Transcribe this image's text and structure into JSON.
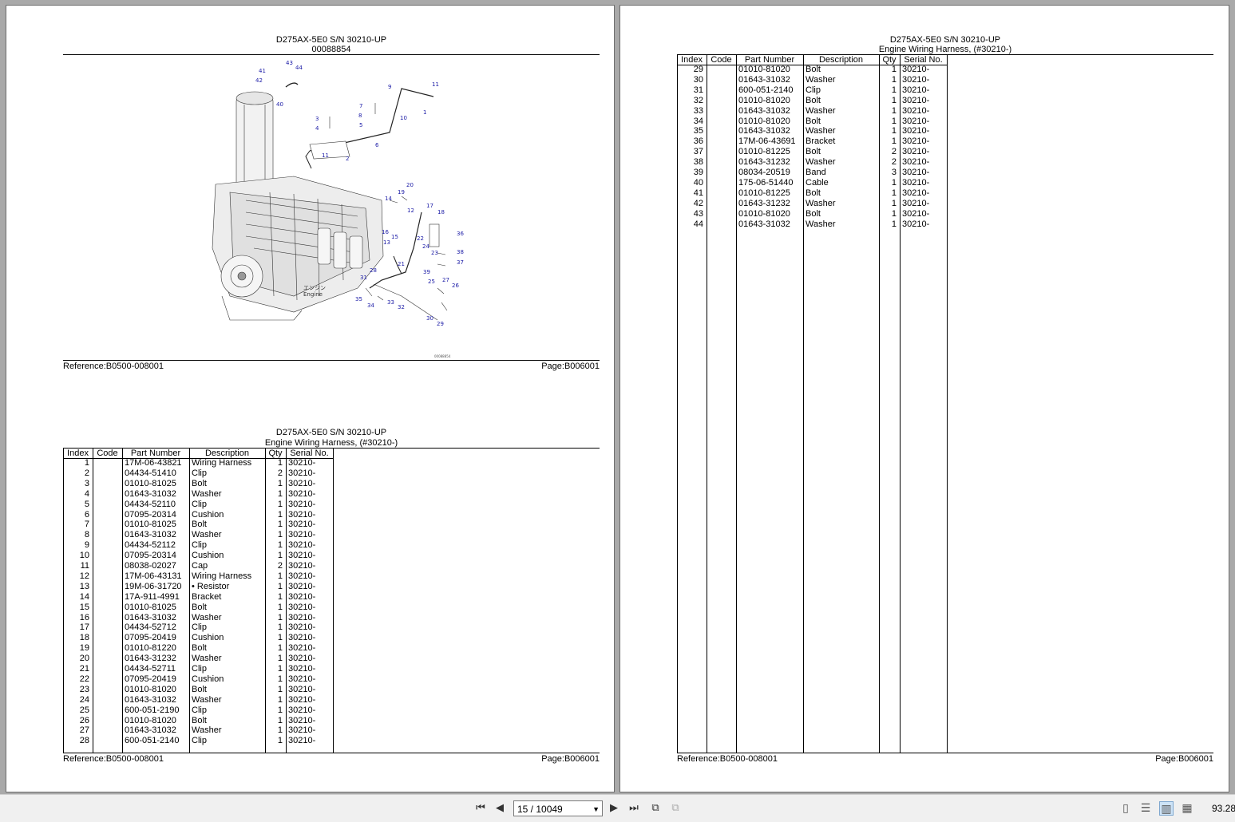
{
  "viewer": {
    "page_indicator": "15 / 10049",
    "zoom": "93.28"
  },
  "icons": {
    "first": "first-page-icon",
    "prev": "previous-page-icon",
    "next": "next-page-icon",
    "last": "last-page-icon"
  },
  "left": {
    "illustration": {
      "title": "D275AX-5E0 S/N 30210-UP",
      "figure_no": "00088854",
      "engine_label_jp": "エンジン",
      "engine_label": "Engine",
      "tiny_code": "00088854",
      "callouts": [
        "1",
        "2",
        "3",
        "4",
        "5",
        "6",
        "7",
        "8",
        "9",
        "10",
        "11",
        "11",
        "12",
        "13",
        "14",
        "15",
        "16",
        "17",
        "18",
        "19",
        "20",
        "21",
        "22",
        "23",
        "24",
        "25",
        "26",
        "27",
        "28",
        "29",
        "30",
        "31",
        "32",
        "33",
        "34",
        "35",
        "36",
        "37",
        "38",
        "40",
        "41",
        "42",
        "43",
        "44"
      ],
      "reference": "Reference:B0500-008001",
      "page": "Page:B006001"
    },
    "parts": {
      "title": "D275AX-5E0 S/N 30210-UP",
      "subtitle": "Engine Wiring Harness, (#30210-)",
      "headers": [
        "Index",
        "Code",
        "Part Number",
        "Description",
        "Qty",
        "Serial No."
      ],
      "rows": [
        [
          "1",
          "",
          "17M-06-43821",
          "Wiring Harness",
          "1",
          "30210-"
        ],
        [
          "2",
          "",
          "04434-51410",
          "Clip",
          "2",
          "30210-"
        ],
        [
          "3",
          "",
          "01010-81025",
          "Bolt",
          "1",
          "30210-"
        ],
        [
          "4",
          "",
          "01643-31032",
          "Washer",
          "1",
          "30210-"
        ],
        [
          "5",
          "",
          "04434-52110",
          "Clip",
          "1",
          "30210-"
        ],
        [
          "6",
          "",
          "07095-20314",
          "Cushion",
          "1",
          "30210-"
        ],
        [
          "7",
          "",
          "01010-81025",
          "Bolt",
          "1",
          "30210-"
        ],
        [
          "8",
          "",
          "01643-31032",
          "Washer",
          "1",
          "30210-"
        ],
        [
          "9",
          "",
          "04434-52112",
          "Clip",
          "1",
          "30210-"
        ],
        [
          "10",
          "",
          "07095-20314",
          "Cushion",
          "1",
          "30210-"
        ],
        [
          "11",
          "",
          "08038-02027",
          "Cap",
          "2",
          "30210-"
        ],
        [
          "12",
          "",
          "17M-06-43131",
          "Wiring Harness",
          "1",
          "30210-"
        ],
        [
          "13",
          "",
          "19M-06-31720",
          "• Resistor",
          "1",
          "30210-"
        ],
        [
          "14",
          "",
          "17A-911-4991",
          "Bracket",
          "1",
          "30210-"
        ],
        [
          "15",
          "",
          "01010-81025",
          "Bolt",
          "1",
          "30210-"
        ],
        [
          "16",
          "",
          "01643-31032",
          "Washer",
          "1",
          "30210-"
        ],
        [
          "17",
          "",
          "04434-52712",
          "Clip",
          "1",
          "30210-"
        ],
        [
          "18",
          "",
          "07095-20419",
          "Cushion",
          "1",
          "30210-"
        ],
        [
          "19",
          "",
          "01010-81220",
          "Bolt",
          "1",
          "30210-"
        ],
        [
          "20",
          "",
          "01643-31232",
          "Washer",
          "1",
          "30210-"
        ],
        [
          "21",
          "",
          "04434-52711",
          "Clip",
          "1",
          "30210-"
        ],
        [
          "22",
          "",
          "07095-20419",
          "Cushion",
          "1",
          "30210-"
        ],
        [
          "23",
          "",
          "01010-81020",
          "Bolt",
          "1",
          "30210-"
        ],
        [
          "24",
          "",
          "01643-31032",
          "Washer",
          "1",
          "30210-"
        ],
        [
          "25",
          "",
          "600-051-2190",
          "Clip",
          "1",
          "30210-"
        ],
        [
          "26",
          "",
          "01010-81020",
          "Bolt",
          "1",
          "30210-"
        ],
        [
          "27",
          "",
          "01643-31032",
          "Washer",
          "1",
          "30210-"
        ],
        [
          "28",
          "",
          "600-051-2140",
          "Clip",
          "1",
          "30210-"
        ]
      ],
      "reference": "Reference:B0500-008001",
      "page": "Page:B006001"
    }
  },
  "right": {
    "parts": {
      "title": "D275AX-5E0 S/N 30210-UP",
      "subtitle": "Engine Wiring Harness, (#30210-)",
      "headers": [
        "Index",
        "Code",
        "Part Number",
        "Description",
        "Qty",
        "Serial No."
      ],
      "rows": [
        [
          "29",
          "",
          "01010-81020",
          "Bolt",
          "1",
          "30210-"
        ],
        [
          "30",
          "",
          "01643-31032",
          "Washer",
          "1",
          "30210-"
        ],
        [
          "31",
          "",
          "600-051-2140",
          "Clip",
          "1",
          "30210-"
        ],
        [
          "32",
          "",
          "01010-81020",
          "Bolt",
          "1",
          "30210-"
        ],
        [
          "33",
          "",
          "01643-31032",
          "Washer",
          "1",
          "30210-"
        ],
        [
          "34",
          "",
          "01010-81020",
          "Bolt",
          "1",
          "30210-"
        ],
        [
          "35",
          "",
          "01643-31032",
          "Washer",
          "1",
          "30210-"
        ],
        [
          "36",
          "",
          "17M-06-43691",
          "Bracket",
          "1",
          "30210-"
        ],
        [
          "37",
          "",
          "01010-81225",
          "Bolt",
          "2",
          "30210-"
        ],
        [
          "38",
          "",
          "01643-31232",
          "Washer",
          "2",
          "30210-"
        ],
        [
          "39",
          "",
          "08034-20519",
          "Band",
          "3",
          "30210-"
        ],
        [
          "40",
          "",
          "175-06-51440",
          "Cable",
          "1",
          "30210-"
        ],
        [
          "41",
          "",
          "01010-81225",
          "Bolt",
          "1",
          "30210-"
        ],
        [
          "42",
          "",
          "01643-31232",
          "Washer",
          "1",
          "30210-"
        ],
        [
          "43",
          "",
          "01010-81020",
          "Bolt",
          "1",
          "30210-"
        ],
        [
          "44",
          "",
          "01643-31032",
          "Washer",
          "1",
          "30210-"
        ]
      ],
      "reference": "Reference:B0500-008001",
      "page": "Page:B006001"
    }
  }
}
